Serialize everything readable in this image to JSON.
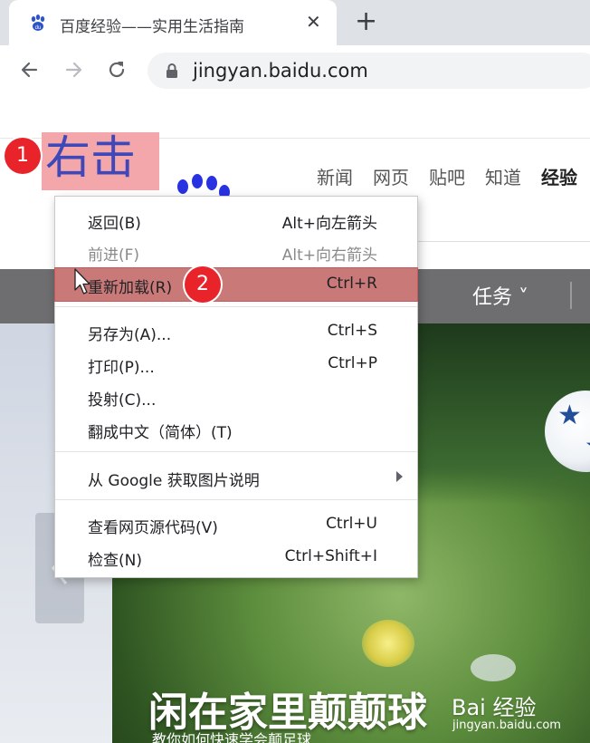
{
  "browser": {
    "tab": {
      "title": "百度经验——实用生活指南",
      "close_glyph": "✕"
    },
    "new_tab_glyph": "+",
    "nav": {
      "back_glyph": "←",
      "forward_glyph": "→",
      "reload_glyph": "↻"
    },
    "omnibox": {
      "url": "jingyan.baidu.com",
      "icon": "lock-icon"
    }
  },
  "page": {
    "site_nav": [
      "新闻",
      "网页",
      "贴吧",
      "知道",
      "经验"
    ],
    "banner_bar": {
      "task_label": "任务 ˅"
    },
    "hero": {
      "title": "闲在家里颠颠球",
      "subtitle": "教你如何快速学会颠足球"
    },
    "watermark": {
      "logo": "Bai 经验",
      "url": "jingyan.baidu.com"
    }
  },
  "annotation": {
    "label": "右击",
    "step1": "1",
    "step2": "2",
    "highlight_color": "#f4a7aa",
    "badge_color": "#e8232a"
  },
  "context_menu": {
    "items": [
      {
        "label": "返回(B)",
        "shortcut": "Alt+向左箭头",
        "enabled": true
      },
      {
        "label": "前进(F)",
        "shortcut": "Alt+向右箭头",
        "enabled": false
      },
      {
        "label": "重新加载(R)",
        "shortcut": "Ctrl+R",
        "enabled": true,
        "highlighted": true
      },
      {
        "label": "另存为(A)...",
        "shortcut": "Ctrl+S",
        "enabled": true
      },
      {
        "label": "打印(P)...",
        "shortcut": "Ctrl+P",
        "enabled": true
      },
      {
        "label": "投射(C)...",
        "shortcut": "",
        "enabled": true
      },
      {
        "label": "翻成中文（简体）(T)",
        "shortcut": "",
        "enabled": true
      },
      {
        "label": "从 Google 获取图片说明",
        "shortcut": "",
        "enabled": true,
        "submenu": true
      },
      {
        "label": "查看网页源代码(V)",
        "shortcut": "Ctrl+U",
        "enabled": true
      },
      {
        "label": "检查(N)",
        "shortcut": "Ctrl+Shift+I",
        "enabled": true
      }
    ]
  }
}
